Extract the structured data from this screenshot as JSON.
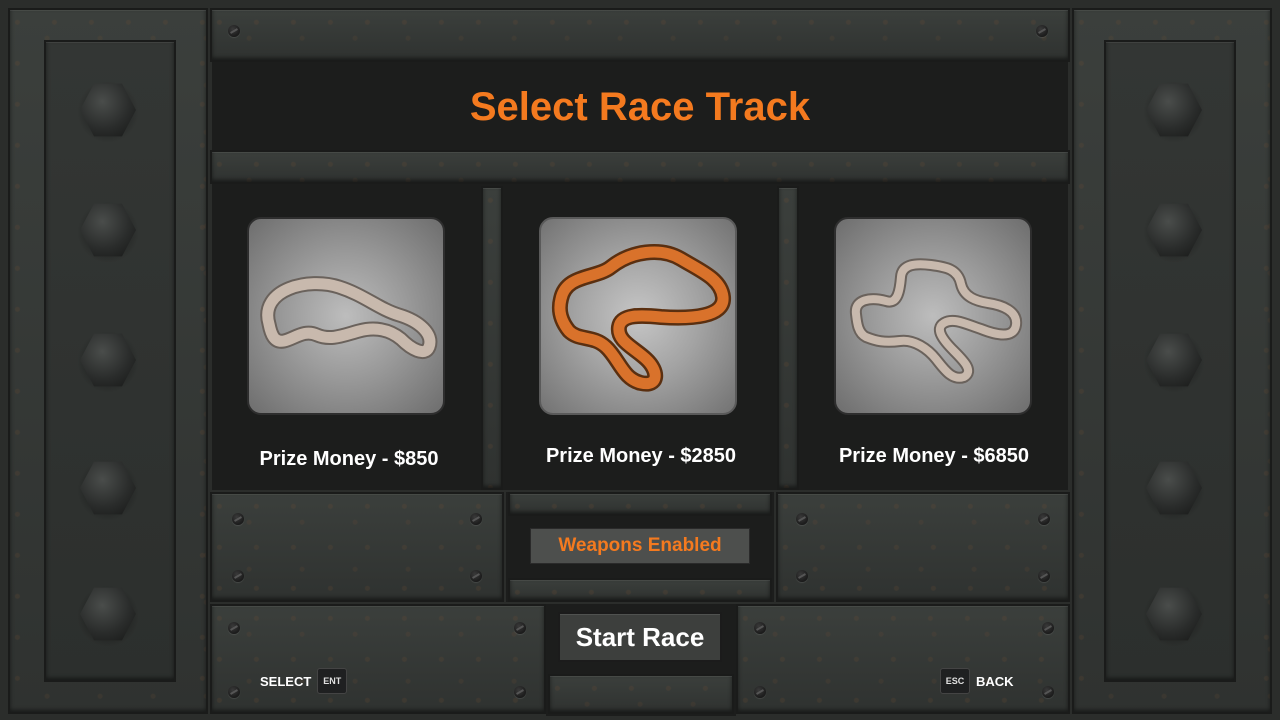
{
  "title": "Select Race Track",
  "tracks": [
    {
      "prize_label": "Prize Money - $850",
      "selected": false
    },
    {
      "prize_label": "Prize Money - $2850",
      "selected": true
    },
    {
      "prize_label": "Prize Money - $6850",
      "selected": false
    }
  ],
  "weapons_label": "Weapons Enabled",
  "start_label": "Start Race",
  "hints": {
    "select_label": "SELECT",
    "select_key": "ENT",
    "back_key": "ESC",
    "back_label": "BACK"
  },
  "colors": {
    "accent": "#f47a1f",
    "selected_track": "#d9722b",
    "track_unselected": "#c8b9ad"
  }
}
